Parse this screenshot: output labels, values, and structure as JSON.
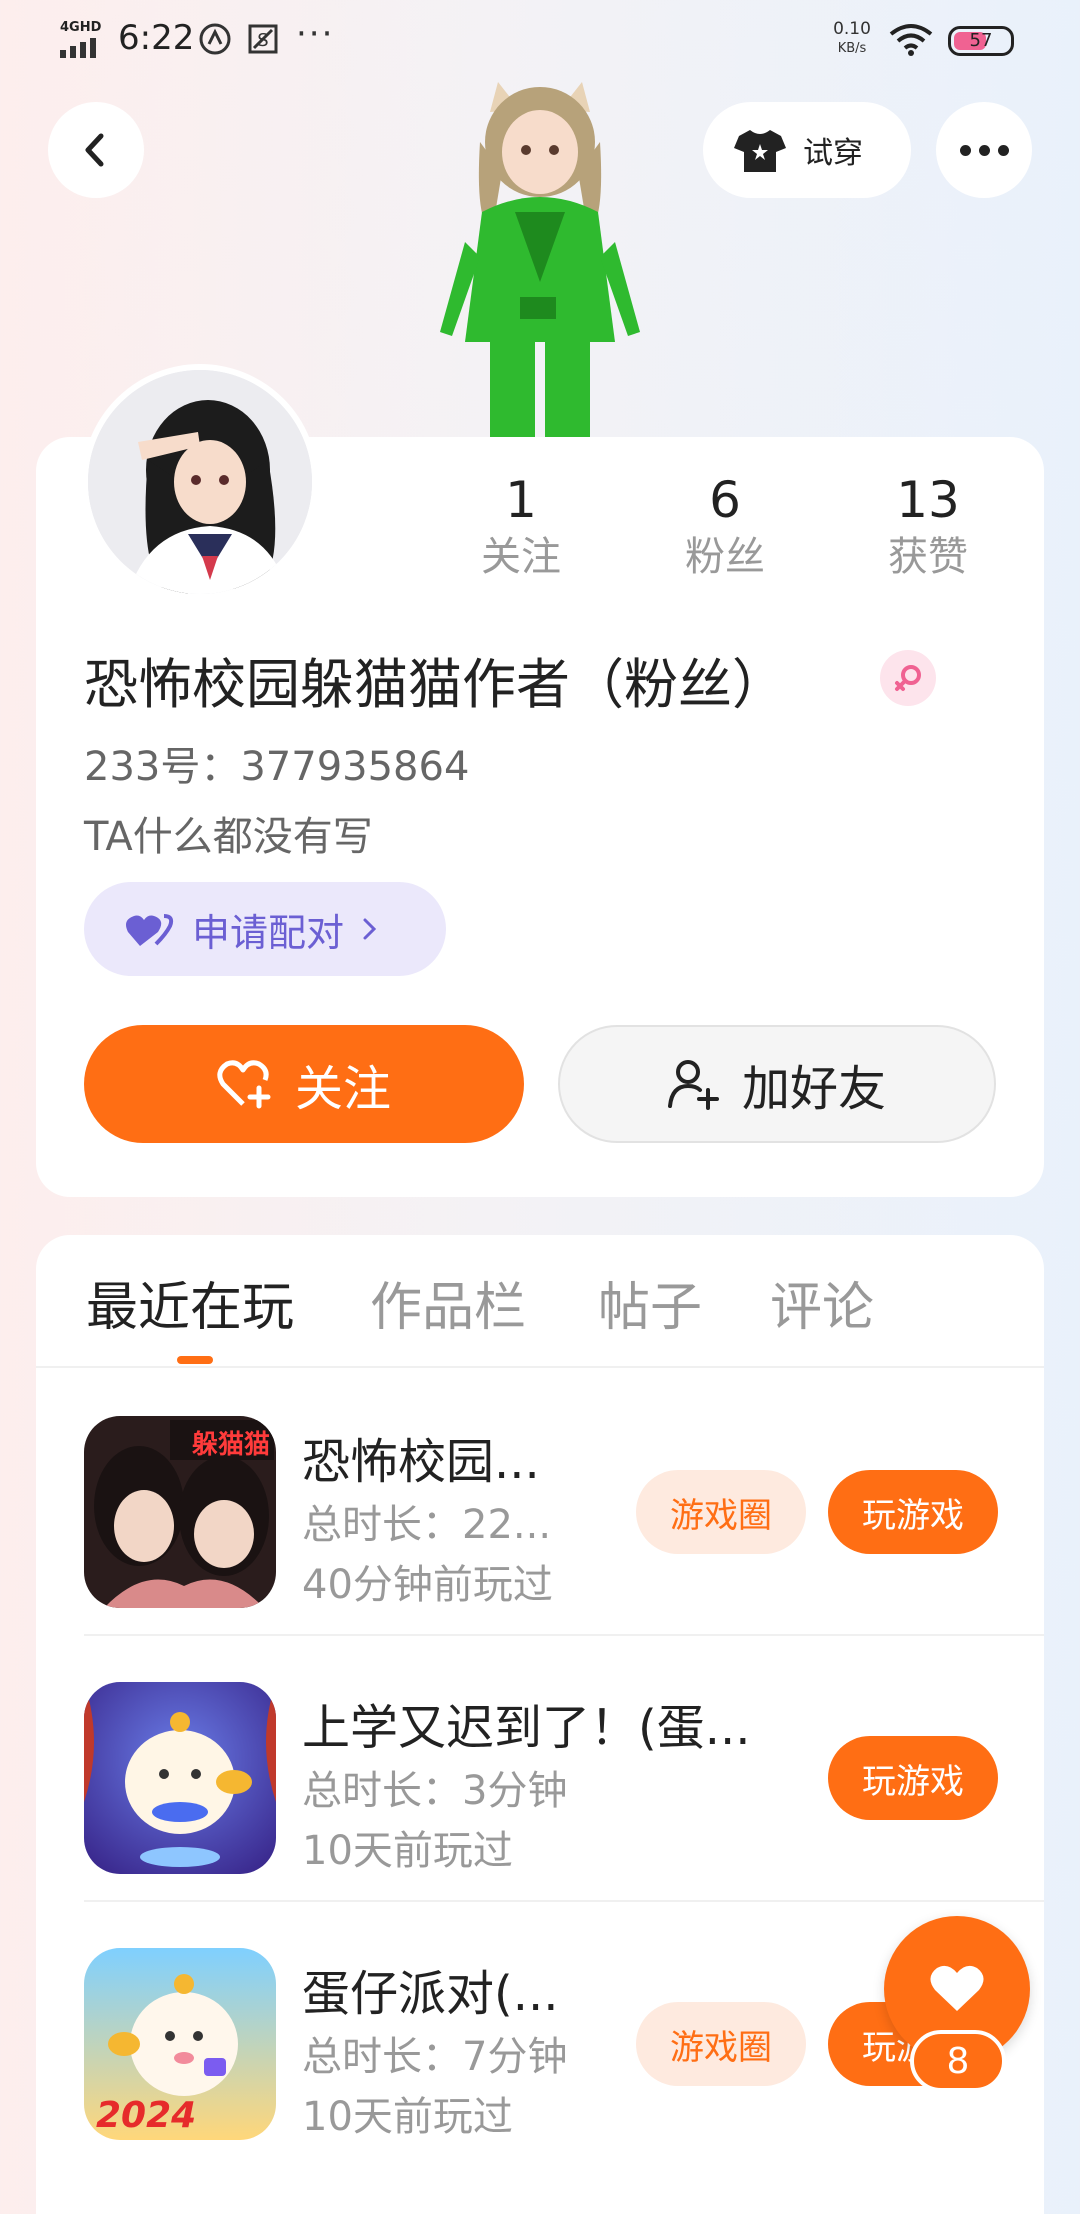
{
  "status_bar": {
    "network": "4GHD",
    "time": "6:22",
    "more": "···",
    "speed_value": "0.10",
    "speed_unit": "KB/s",
    "battery": "57"
  },
  "header": {
    "tryon_label": "试穿",
    "back_icon": "chevron-left-icon",
    "more_icon": "more-horizontal-icon"
  },
  "profile": {
    "stats": [
      {
        "value": "1",
        "label": "关注"
      },
      {
        "value": "6",
        "label": "粉丝"
      },
      {
        "value": "13",
        "label": "获赞"
      }
    ],
    "nickname": "恐怖校园躲猫猫作者（粉丝）",
    "gender": "female",
    "uid": "233号：377935864",
    "bio": "TA什么都没有写",
    "pair_label": "申请配对",
    "follow_label": "关注",
    "add_friend_label": "加好友"
  },
  "tabs": [
    {
      "label": "最近在玩",
      "active": true
    },
    {
      "label": "作品栏",
      "active": false
    },
    {
      "label": "帖子",
      "active": false
    },
    {
      "label": "评论",
      "active": false
    }
  ],
  "games": [
    {
      "title": "恐怖校园...",
      "duration": "总时长：22...",
      "last_played": "40分钟前玩过",
      "icon_label": "躲猫猫",
      "circle_label": "游戏圈",
      "play_label": "玩游戏"
    },
    {
      "title": "上学又迟到了！(蛋...",
      "duration": "总时长：3分钟",
      "last_played": "10天前玩过",
      "play_label": "玩游戏"
    },
    {
      "title": "蛋仔派对(...",
      "duration": "总时长：7分钟",
      "last_played": "10天前玩过",
      "icon_label": "2024",
      "circle_label": "游戏圈",
      "play_label": "玩游戏"
    }
  ],
  "floating_like": {
    "count": "8"
  },
  "colors": {
    "accent": "#ff6e14",
    "pair": "#6b5fd3",
    "gender": "#f06292"
  }
}
